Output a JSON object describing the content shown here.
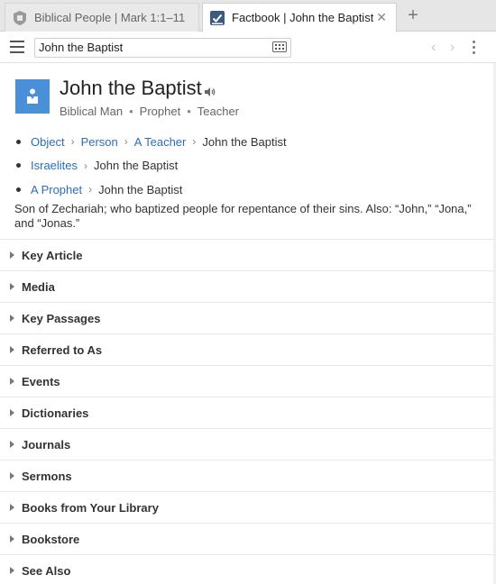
{
  "tabs": [
    {
      "label": "Biblical People | Mark 1:1–11",
      "icon": "shield-icon"
    },
    {
      "label": "Factbook | John the Baptist",
      "icon": "factbook-icon"
    }
  ],
  "new_tab_symbol": "+",
  "close_symbol": "✕",
  "search": {
    "value": "John the Baptist"
  },
  "header": {
    "title": "John the Baptist",
    "subtitle": [
      "Biblical Man",
      "Prophet",
      "Teacher"
    ]
  },
  "breadcrumbs": [
    {
      "links": [
        "Object",
        "Person",
        "A Teacher"
      ],
      "current": "John the Baptist"
    },
    {
      "links": [
        "Israelites"
      ],
      "current": "John the Baptist"
    },
    {
      "links": [
        "A Prophet"
      ],
      "current": "John the Baptist"
    }
  ],
  "description": "Son of Zechariah; who baptized people for repentance of their sins. Also: “John,” “Jona,” and “Jonas.”",
  "sections": [
    "Key Article",
    "Media",
    "Key Passages",
    "Referred to As",
    "Events",
    "Dictionaries",
    "Journals",
    "Sermons",
    "Books from Your Library",
    "Bookstore",
    "See Also"
  ],
  "colors": {
    "accent": "#4a90d9",
    "link": "#2a6ebb"
  }
}
